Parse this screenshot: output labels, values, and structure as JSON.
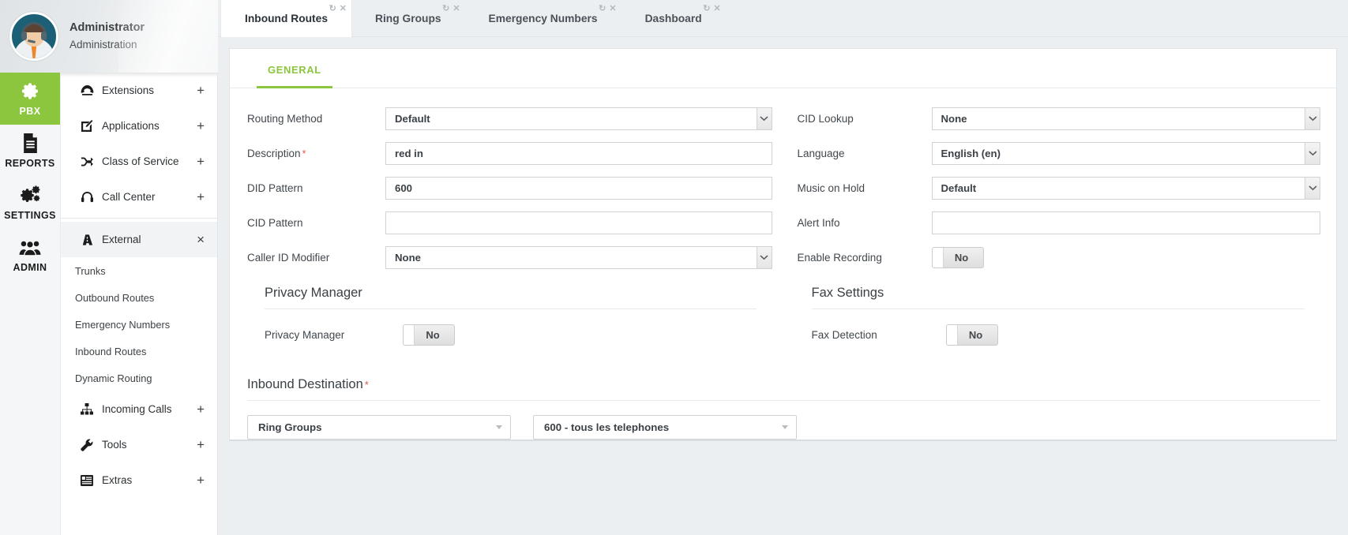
{
  "user": {
    "name": "Administrator",
    "role": "Administration",
    "avatar_icon": "operator-avatar-icon"
  },
  "rail": {
    "items": [
      {
        "label": "PBX",
        "icon": "gear-icon",
        "active": true
      },
      {
        "label": "REPORTS",
        "icon": "document-icon",
        "active": false
      },
      {
        "label": "SETTINGS",
        "icon": "gears-icon",
        "active": false
      },
      {
        "label": "ADMIN",
        "icon": "users-icon",
        "active": false
      }
    ],
    "active_color": "#8cc63e"
  },
  "menu": {
    "group_a": [
      {
        "label": "Extensions",
        "icon": "phone-icon",
        "expander": "+"
      },
      {
        "label": "Applications",
        "icon": "edit-square-icon",
        "expander": "+"
      },
      {
        "label": "Class of Service",
        "icon": "shuffle-icon",
        "expander": "+"
      },
      {
        "label": "Call Center",
        "icon": "headset-icon",
        "expander": "+"
      }
    ],
    "external": {
      "label": "External",
      "icon": "road-icon",
      "expander": "×",
      "selected": true
    },
    "sub_items": [
      {
        "label": "Trunks"
      },
      {
        "label": "Outbound Routes"
      },
      {
        "label": "Emergency Numbers"
      },
      {
        "label": "Inbound Routes"
      },
      {
        "label": "Dynamic Routing"
      }
    ],
    "group_b": [
      {
        "label": "Incoming Calls",
        "icon": "sitemap-icon",
        "expander": "+"
      },
      {
        "label": "Tools",
        "icon": "wrench-icon",
        "expander": "+"
      },
      {
        "label": "Extras",
        "icon": "list-box-icon",
        "expander": "+"
      }
    ]
  },
  "tabs": [
    {
      "label": "Inbound Routes",
      "active": true,
      "refresh_icon": "refresh-icon",
      "close_icon": "close-icon"
    },
    {
      "label": "Ring Groups",
      "active": false,
      "refresh_icon": "refresh-icon",
      "close_icon": "close-icon"
    },
    {
      "label": "Emergency Numbers",
      "active": false,
      "refresh_icon": "refresh-icon",
      "close_icon": "close-icon"
    },
    {
      "label": "Dashboard",
      "active": false,
      "refresh_icon": "refresh-icon",
      "close_icon": "close-icon"
    }
  ],
  "form": {
    "section_tab": "GENERAL",
    "left": {
      "routing_method": {
        "label": "Routing Method",
        "value": "Default",
        "type": "select"
      },
      "description": {
        "label": "Description",
        "required": "*",
        "value": "red in",
        "placeholder": "",
        "type": "text"
      },
      "did_pattern": {
        "label": "DID Pattern",
        "value": "600",
        "placeholder": "",
        "type": "text"
      },
      "cid_pattern": {
        "label": "CID Pattern",
        "value": "",
        "placeholder": "",
        "type": "text"
      },
      "caller_id_modifier": {
        "label": "Caller ID Modifier",
        "value": "None",
        "type": "select"
      }
    },
    "right": {
      "cid_lookup": {
        "label": "CID Lookup",
        "value": "None",
        "type": "select"
      },
      "language": {
        "label": "Language",
        "value": "English (en)",
        "type": "select"
      },
      "music_on_hold": {
        "label": "Music on Hold",
        "value": "Default",
        "type": "select"
      },
      "alert_info": {
        "label": "Alert Info",
        "value": "",
        "placeholder": "",
        "type": "text"
      },
      "enable_recording": {
        "label": "Enable Recording",
        "value": "No",
        "type": "toggle"
      }
    },
    "privacy_manager": {
      "title": "Privacy Manager",
      "field": {
        "label": "Privacy Manager",
        "value": "No",
        "type": "toggle"
      }
    },
    "fax_settings": {
      "title": "Fax Settings",
      "field": {
        "label": "Fax Detection",
        "value": "No",
        "type": "toggle"
      }
    },
    "inbound_destination": {
      "title": "Inbound Destination",
      "required": "*",
      "type_select": {
        "value": "Ring Groups"
      },
      "target_select": {
        "value": "600 - tous les telephones"
      }
    }
  }
}
